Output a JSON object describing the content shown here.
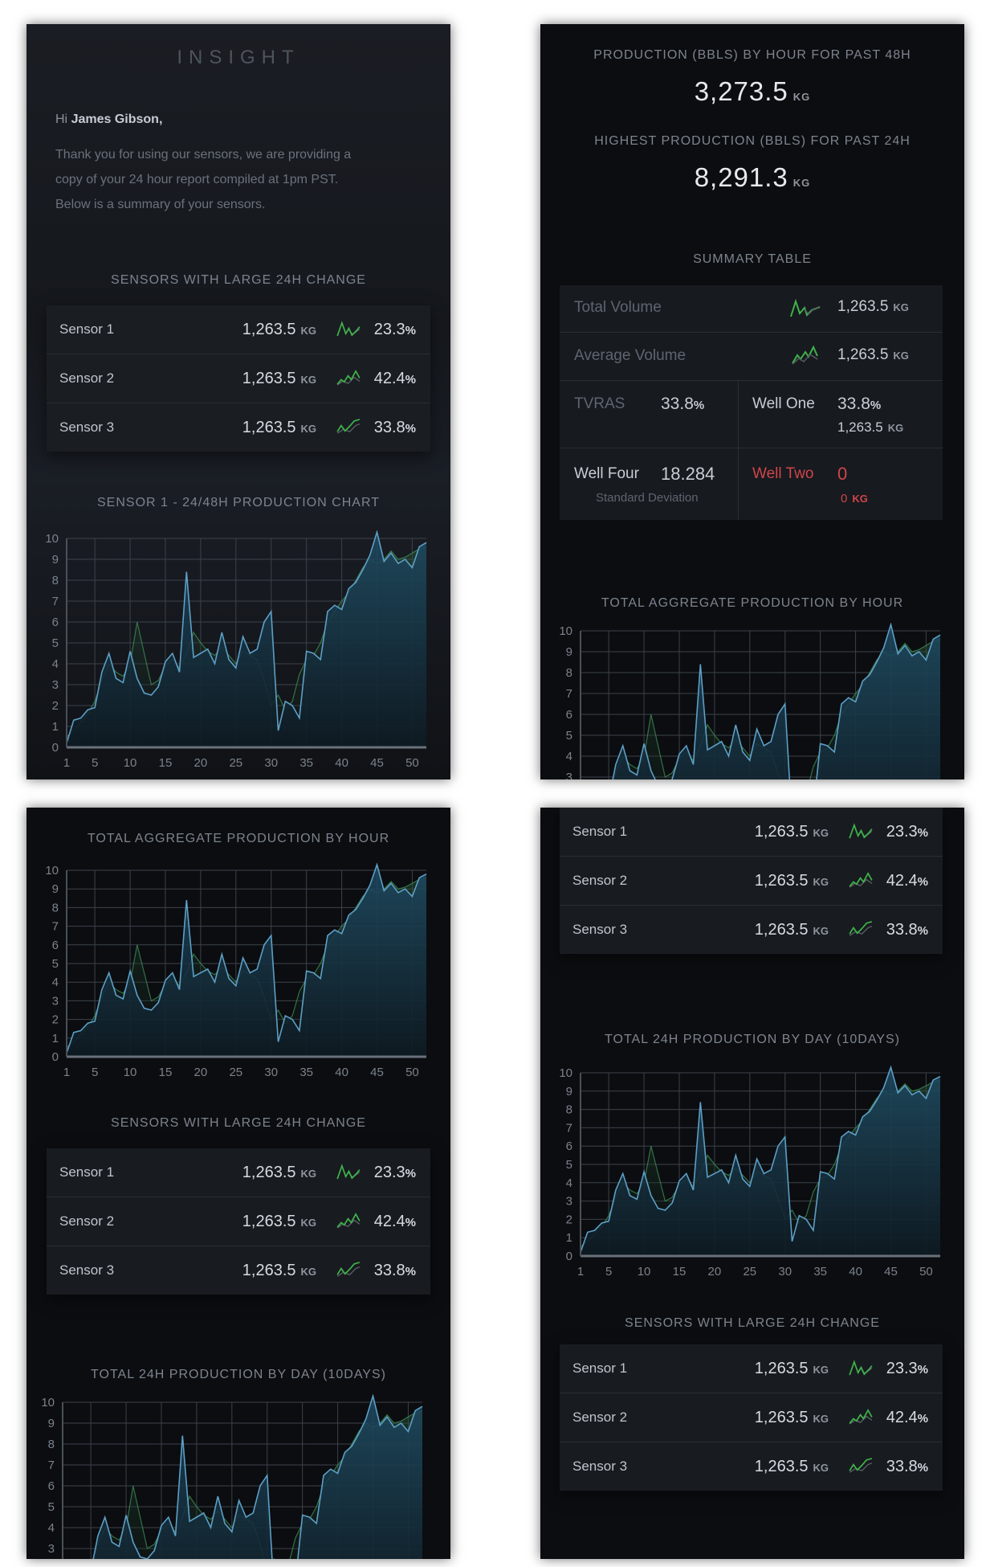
{
  "brand": "INSIGHT",
  "greeting": {
    "prefix": "Hi ",
    "name": "James Gibson,"
  },
  "intro": [
    "Thank you for using our sensors, we are providing a",
    "copy of your 24 hour report compiled at 1pm PST.",
    "Below is a summary of your sensors."
  ],
  "sensors_title": "SENSORS WITH LARGE 24H CHANGE",
  "sensors": [
    {
      "name": "Sensor 1",
      "value": "1,263.5",
      "unit": "KG",
      "pct": "23.3",
      "pct_unit": "%"
    },
    {
      "name": "Sensor 2",
      "value": "1,263.5",
      "unit": "KG",
      "pct": "42.4",
      "pct_unit": "%"
    },
    {
      "name": "Sensor 3",
      "value": "1,263.5",
      "unit": "KG",
      "pct": "33.8",
      "pct_unit": "%"
    }
  ],
  "chart_titles": {
    "sensor1": "SENSOR 1 - 24/48H PRODUCTION CHART",
    "aggregate": "TOTAL AGGREGATE PRODUCTION BY HOUR",
    "daily": "TOTAL 24H PRODUCTION BY DAY (10DAYS)"
  },
  "production_48h": {
    "label": "PRODUCTION (BBLS) BY HOUR FOR PAST 48H",
    "value": "3,273.5",
    "unit": "KG"
  },
  "highest_24h": {
    "label": "HIGHEST PRODUCTION (BBLS) FOR PAST 24H",
    "value": "8,291.3",
    "unit": "KG"
  },
  "summary": {
    "title": "SUMMARY TABLE",
    "total_volume": {
      "label": "Total Volume",
      "value": "1,263.5",
      "unit": "KG"
    },
    "average_volume": {
      "label": "Average Volume",
      "value": "1,263.5",
      "unit": "KG"
    },
    "tvras": {
      "label": "TVRAS",
      "value": "33.8",
      "unit": "%"
    },
    "well_one": {
      "label": "Well One",
      "value": "33.8",
      "unit": "%",
      "sub_value": "1,263.5",
      "sub_unit": "KG"
    },
    "well_four": {
      "label": "Well Four",
      "value": "18.284",
      "sub_label": "Standard Deviation"
    },
    "well_two": {
      "label": "Well Two",
      "value": "0",
      "sub_value": "0",
      "sub_unit": "KG"
    }
  },
  "colors": {
    "background": "#0b0d10",
    "up_green": "#3fb24a",
    "alert_red": "#d0454a",
    "line_blue": "#5d9fc6",
    "line_green": "#3f8a55"
  },
  "chart_data": {
    "type": "area",
    "x": [
      1,
      2,
      3,
      4,
      5,
      6,
      7,
      8,
      9,
      10,
      11,
      12,
      13,
      14,
      15,
      16,
      17,
      18,
      19,
      20,
      21,
      22,
      23,
      24,
      25,
      26,
      27,
      28,
      29,
      30,
      31,
      32,
      33,
      34,
      35,
      36,
      37,
      38,
      39,
      40,
      41,
      42,
      43,
      44,
      45,
      46,
      47,
      48,
      49,
      50,
      51,
      52
    ],
    "series": [
      {
        "values": [
          0.2,
          1.3,
          1.4,
          1.8,
          1.9,
          3.6,
          4.5,
          3.3,
          3.1,
          4.6,
          3.3,
          2.6,
          2.5,
          2.9,
          4.1,
          4.5,
          3.6,
          8.4,
          4.3,
          4.5,
          4.7,
          4.0,
          5.5,
          4.2,
          3.8,
          5.3,
          4.5,
          4.7,
          6.0,
          6.5,
          0.8,
          2.2,
          2.0,
          1.4,
          4.6,
          4.5,
          4.2,
          6.5,
          6.8,
          6.6,
          7.6,
          7.9,
          8.5,
          9.2,
          10.3,
          8.9,
          9.3,
          8.8,
          9.0,
          8.6,
          9.6,
          9.8
        ]
      },
      {
        "values": [
          0.5,
          0.8,
          1.2,
          1.6,
          2.2,
          3.2,
          4.0,
          3.6,
          3.4,
          4.0,
          6.0,
          4.5,
          3.0,
          3.2,
          3.9,
          4.2,
          3.8,
          4.5,
          5.5,
          5.0,
          4.6,
          4.4,
          4.8,
          4.4,
          4.0,
          4.6,
          4.4,
          4.2,
          3.2,
          2.0,
          2.5,
          1.8,
          2.2,
          3.5,
          4.2,
          4.4,
          5.0,
          6.0,
          6.5,
          7.0,
          7.4,
          8.0,
          8.6,
          9.0,
          8.8,
          9.0,
          9.4,
          9.0,
          9.1,
          9.3,
          9.5,
          9.6
        ]
      }
    ],
    "xticks": [
      1,
      5,
      10,
      15,
      20,
      25,
      30,
      35,
      40,
      45,
      50
    ],
    "yticks": [
      0,
      1,
      2,
      3,
      4,
      5,
      6,
      7,
      8,
      9,
      10
    ],
    "xlim": [
      1,
      52
    ],
    "ylim": [
      0,
      10
    ],
    "grid": true
  }
}
